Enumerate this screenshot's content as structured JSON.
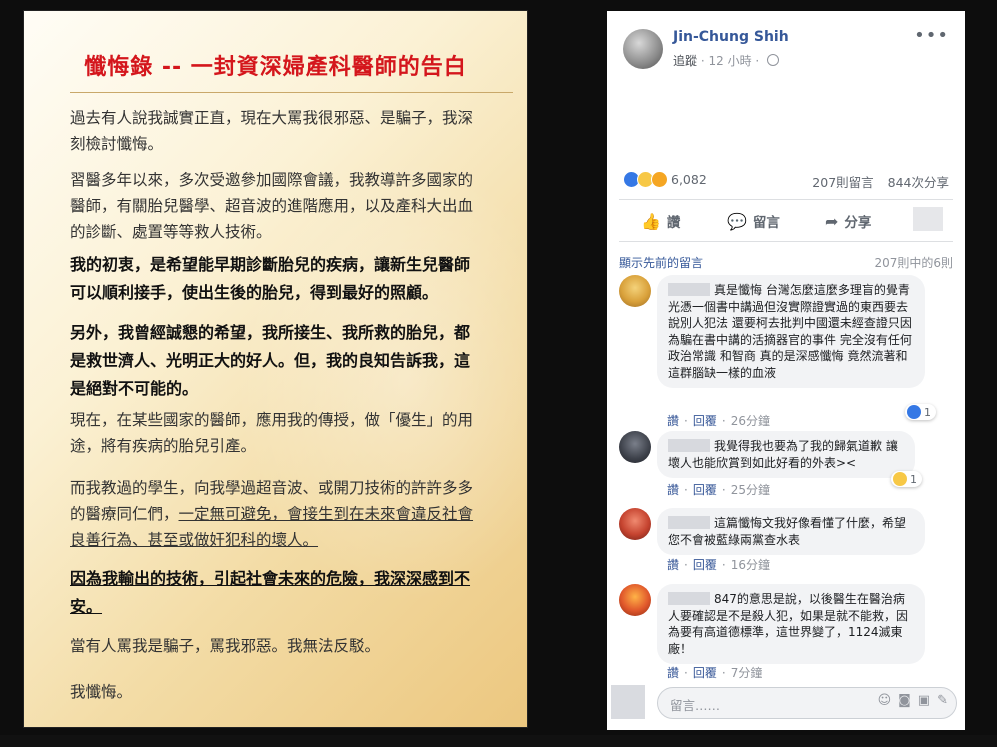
{
  "post_image": {
    "title": "懺悔錄 -- 一封資深婦產科醫師的告白",
    "paragraphs": [
      "過去有人說我誠實正直，現在大罵我很邪惡、是騙子，我深刻檢討懺悔。",
      "習醫多年以來，多次受邀參加國際會議，我教導許多國家的醫師，有關胎兒醫學、超音波的進階應用，以及產科大出血的診斷、處置等等救人技術。",
      "我的初衷，是希望能早期診斷胎兒的疾病，讓新生兒醫師可以順利接手，使出生後的胎兒，得到最好的照顧。",
      "另外，我曾經誠懇的希望，我所接生、我所救的胎兒，都是救世濟人、光明正大的好人。但，我的良知告訴我，這是絕對不可能的。",
      "現在，在某些國家的醫師，應用我的傳授，做「優生」的用途，將有疾病的胎兒引產。",
      "而我教過的學生，向我學過超音波、或開刀技術的許許多多的醫療同仁們，",
      "一定無可避免，會接生到在未來會違反社會良善行為、甚至或做奸犯科的壞人。",
      "因為我輸出的技術，引起社會未來的危險，我深深感到不安。",
      "當有人罵我是騙子，罵我邪惡。我無法反駁。",
      "我懺悔。"
    ]
  },
  "post": {
    "author": "Jin-Chung Shih",
    "follow_label": "追蹤",
    "time": "12 小時",
    "more": "•••",
    "reaction_count": "6,082",
    "comments_count": "207則留言",
    "shares_count": "844次分享",
    "actions": {
      "like": "讚",
      "comment": "留言",
      "share": "分享"
    },
    "prev_comments_label": "顯示先前的留言",
    "comments_of_label": "207則中的6則"
  },
  "comments": [
    {
      "text": "真是懺悔 台灣怎麼這麼多理盲的覺青 光憑一個書中講過但沒實際證實過的東西要去說別人犯法 還要柯去批判中國還未經查證只因為騙在書中講的活摘器官的事件 完全沒有任何政治常識 和智商 真的是深感懺悔 竟然流著和這群腦缺一樣的血液",
      "like": "讚",
      "reply": "回覆",
      "time": "26分鐘",
      "react_count": "1"
    },
    {
      "text": "我覺得我也要為了我的歸氣道歉 讓壞人也能欣賞到如此好看的外表><",
      "like": "讚",
      "reply": "回覆",
      "time": "25分鐘",
      "react_count": "1"
    },
    {
      "text": "這篇懺悔文我好像看懂了什麼，希望您不會被藍綠兩黨查水表",
      "like": "讚",
      "reply": "回覆",
      "time": "16分鐘"
    },
    {
      "text": "847的意思是說，以後醫生在醫治病人要確認是不是殺人犯，如果是就不能救，因為要有高道德標準，這世界變了，1124滅東廠！",
      "like": "讚",
      "reply": "回覆",
      "time": "7分鐘"
    }
  ],
  "composer": {
    "placeholder": "留言……"
  },
  "colors": {
    "title_red": "#d4161c",
    "link_blue": "#365899",
    "like_blue": "#3578e5"
  }
}
